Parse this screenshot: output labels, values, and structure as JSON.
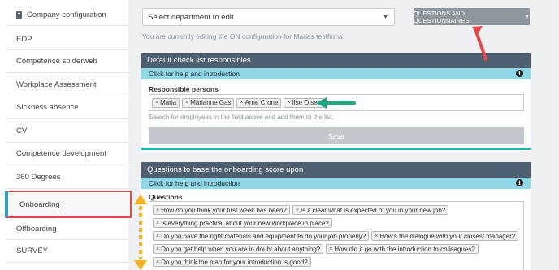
{
  "sidebar": {
    "items": [
      {
        "label": "Company configuration",
        "icon": "building-icon"
      },
      {
        "label": "EDP"
      },
      {
        "label": "Competence spiderweb"
      },
      {
        "label": "Workplace Assessment"
      },
      {
        "label": "Sickness absence"
      },
      {
        "label": "CV"
      },
      {
        "label": "Competence development"
      },
      {
        "label": "360 Degrees"
      },
      {
        "label": "Onboarding",
        "active": true
      },
      {
        "label": "Offboarding"
      },
      {
        "label": "SURVEY"
      }
    ]
  },
  "header": {
    "department_select": "Select department to edit",
    "questions_button": "QUESTIONS AND QUESTIONNAIRES",
    "editing_note": "You are currently editing the ON configuration for Marias testfirma."
  },
  "checklist_panel": {
    "title": "Default check list responsibles",
    "help_label": "Click for help and introduction",
    "field_label": "Responsible persons",
    "tags": [
      "Maria",
      "Marianne Gas",
      "Arne Crone",
      "Ilse Olsen"
    ],
    "hint": "Search for employees in the field above and add them to the list.",
    "save_label": "Save"
  },
  "questions_panel": {
    "title": "Questions to base the onboarding score upon",
    "help_label": "Click for help and introduction",
    "field_label": "Questions",
    "question_rows": [
      [
        "How do you think your first week has been?",
        "Is it clear what is expected of you in your new job?"
      ],
      [
        "Is everything practical about your new workplace in place?"
      ],
      [
        "Do you have the right materials and equipment to do your job properly?",
        "How's the dialogue with your closest manager?"
      ],
      [
        "Do you get help when you are in doubt about anything?",
        "How did it go with the introduction to colleagues?"
      ],
      [
        "Do you think the plan for your introduction is good?"
      ]
    ]
  },
  "colors": {
    "header_bar": "#4f5f72",
    "help_bar": "#8fd6e6",
    "accent_teal": "#1fb6a8",
    "active_border": "#e0494a",
    "annotation_red": "#e8454a",
    "annotation_green": "#1aa981",
    "annotation_orange": "#f6b21b"
  }
}
